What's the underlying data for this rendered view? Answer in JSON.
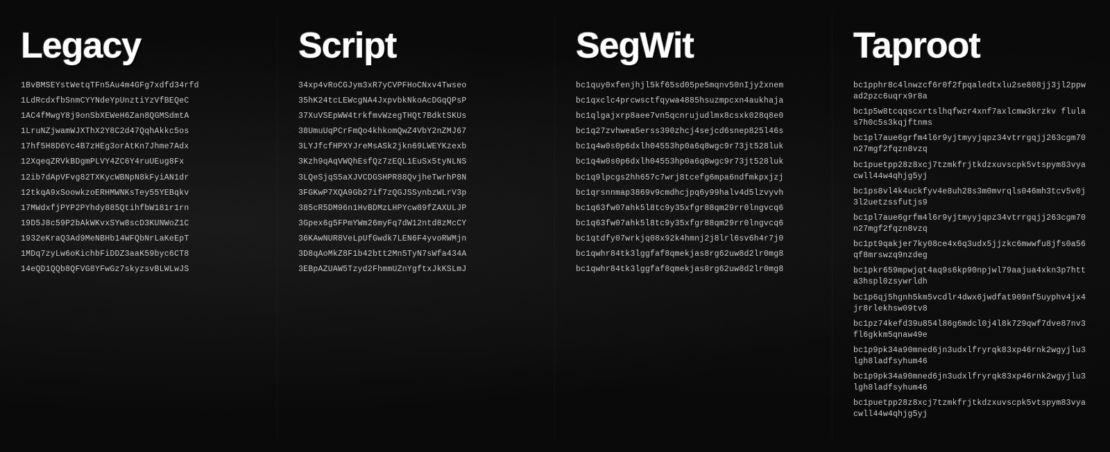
{
  "columns": [
    {
      "id": "legacy",
      "title": "Legacy",
      "addresses": [
        "1BvBMSEYstWetqTFn5Au4m4GFg7xdfd34rfd",
        "1LdRcdxfbSnmCYYNdeYpUnztiYzVfBEQeC",
        "1AC4fMwgY8j9onSbXEWeH6Zan8QGMSdmtA",
        "1LruNZjwamWJXThX2Y8C2d47QqhAkkc5os",
        "17hf5H8D6Yc4B7zHEg3orAtKn7Jhme7Adx",
        "12XqeqZRVkBDgmPLVY4ZC6Y4ruUEug8Fx",
        "12ib7dApVFvg82TXKycWBNpN8kFyiAN1dr",
        "12tkqA9xSoowkzoERHMWNKsTey55YEBqkv",
        "17MWdxfjPYP2PYhdy885QtihfbW181r1rn",
        "19D5J8c59P2bAkWKvxSYw8scD3KUNWoZ1C",
        "1932eKraQ3Ad9MeNBHb14WFQbNrLaKeEpT",
        "1MDq7zyLw6oKichbFiDDZ3aaK59byc6CT8",
        "14eQD1QQb8QFVG8YFwGz7skyzsvBLWLwJS"
      ]
    },
    {
      "id": "script",
      "title": "Script",
      "addresses": [
        "34xp4vRoCGJym3xR7yCVPFHoCNxv4Twseo",
        "35hK24tcLEWcgNA4JxpvbkNkoAcDGqQPsP",
        "37XuVSEpWW4trkfmvWzegTHQt7BdktSKUs",
        "38UmuUqPCrFmQo4khkomQwZ4VbY2nZMJ67",
        "3LYJfcfHPXYJreMsASk2jkn69LWEYKzexb",
        "3Kzh9qAqVWQhEsfQz7zEQL1EuSx5tyNLNS",
        "3LQeSjqS5aXJVCDGSHPR88QvjheTwrhP8N",
        "3FGKwP7XQA9Gb27if7zQGJSSynbzWLrV3p",
        "385cR5DM96n1HvBDMzLHPYcw89fZAXULJP",
        "3Gpex6g5FPmYWm26myFq7dW12ntd8zMcCY",
        "36KAwNUR8VeLpUfGwdk7LEN6F4yvoRWMjn",
        "3D8qAoMkZ8F1b42btt2Mn5TyN7sWfa434A",
        "3EBpAZUAW5Tzyd2FhmmUZnYgftxJkKSLmJ"
      ]
    },
    {
      "id": "segwit",
      "title": "SegWit",
      "addresses": [
        "bc1quy0xfenjhjl5kf65sd05pe5mqnv50nIjyžxnem",
        "bc1qxclc4prcwsctfqywa4885hsuzmpcxn4aukhaja",
        "bc1qlgajxrp8aee7vn5qcnrujudlmx8csxk028q8e0",
        "bc1q27zvhwea5erss390zhcj4sejcd6snep825l46s",
        "bc1q4w0s0p6dxlh04553hp0a6q8wgc9r73jt528luk",
        "bc1q4w0s0p6dxlh04553hp0a6q8wgc9r73jt528luk",
        "bc1q9lpcgs2hh657c7wrj8tcefg6mpa6ndfmkpxjzj",
        "bc1qrsnnmap3869v9cmdhcjpq6y99halv4d5lzvyvh",
        "bc1q63fw07ahk5l8tc9y35xfgr88qm29rr0lngvcq6",
        "bc1q63fw07ahk5l8tc9y35xfgr88qm29rr0lngvcq6",
        "bc1qtdfy07wrkjq08x92k4hmnj2j8lrl6sv6h4r7j0",
        "bc1qwhr84tk3lggfaf8qmekjas8rg62uw8d2lr0mg8",
        "bc1qwhr84tk3lggfaf8qmekjas8rg62uw8d2lr0mg8"
      ]
    },
    {
      "id": "taproot",
      "title": "Taproot",
      "addresses": [
        "bc1pphr8c4lnwzcf6r0f2fpqaledtxlu2se808jj3jl2ppwad2pzc6uqrx9r8a",
        "bc1p5w8tcqqscxrtslhqfwzr4xnf7axlcmw3krzkv flulas7h0c5s3kqjftnms",
        "bc1pl7aue6grfm4l6r9yjtmyyjqpz34vtrrgqjj263cgm70n27mgf2fqzn8vzq",
        "bc1puetpp28z8xcj7tzmkfrjtkdzxuvscpk5vtspym83vyacwll44w4qhjg5yj",
        "bc1ps8vl4k4uckfyv4e8uh28s3m0mvrqls046mh3tcv5v0j3l2uetzssfutjs9",
        "bc1pl7aue6grfm4l6r9yjtmyyjqpz34vtrrgqjj263cgm70n27mgf2fqzn8vzq",
        "bc1pt9qakjer7ky08ce4x6q3udx5jjzkc6mwwfu8jfs0a56qf8mrswzq9nzdeg",
        "bc1pkr659mpwjqt4aq9s6kp90npjwl79aajua4xkn3p7htta3hspl0zsywrldh",
        "bc1p6qj5hgnh5km5vcdlr4dwx6jwdfat909nf5uyphv4jx4jr8rlekhsw09tv8",
        "bc1pz74kefd39u854l86g6mdcl0j4l8k729qwf7dve87nv3fl6gkkm5qnaw49e",
        "bc1p9pk34a90mned6jn3udxlfryrqk83xp46rnk2wgyjlu3lgh8ladfsyhum46",
        "bc1p9pk34a90mned6jn3udxlfryrqk83xp46rnk2wgyjlu3lgh8ladfsyhum46",
        "bc1puetpp28z8xcj7tzmkfrjtkdzxuvscpk5vtspym83vyacwll44w4qhjg5yj"
      ]
    }
  ]
}
